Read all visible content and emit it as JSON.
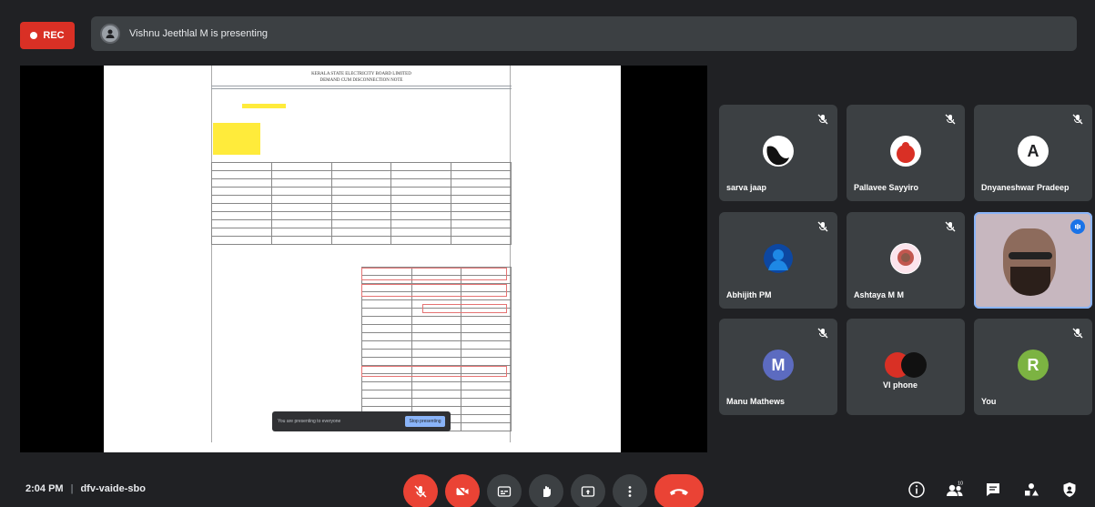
{
  "header": {
    "rec_label": "REC",
    "presenting_text": "Vishnu Jeethlal M is presenting"
  },
  "document": {
    "title_line1": "KERALA STATE ELECTRICITY BOARD LIMITED",
    "title_line2": "DEMAND CUM DISCONNECTION NOTE",
    "caption_text": "You are presenting to everyone",
    "caption_button": "Stop presenting"
  },
  "participants": [
    {
      "name": "sarva jaap",
      "avatar_letter": "",
      "avatar_color": "#ffffff",
      "muted": true
    },
    {
      "name": "Pallavee Sayyiro",
      "avatar_letter": "",
      "avatar_color": "#d93025",
      "muted": true
    },
    {
      "name": "Dnyaneshwar Pradeep",
      "avatar_letter": "A",
      "avatar_color": "#ffffff",
      "muted": true
    },
    {
      "name": "Abhijith PM",
      "avatar_letter": "",
      "avatar_color": "#1a73e8",
      "muted": true
    },
    {
      "name": "Ashtaya M M",
      "avatar_letter": "",
      "avatar_color": "#c2574f",
      "muted": true
    },
    {
      "name": "",
      "video": true,
      "muted": false
    },
    {
      "name": "Manu Mathews",
      "avatar_letter": "M",
      "avatar_color": "#5c6bc0",
      "muted": true
    },
    {
      "name": "VI phone",
      "avatar_letter": "",
      "avatar_color": "#d93025",
      "muted": false
    },
    {
      "name": "You",
      "avatar_letter": "R",
      "avatar_color": "#7cb342",
      "muted": true
    }
  ],
  "footer": {
    "time": "2:04 PM",
    "meeting_code": "dfv-vaide-sbo"
  },
  "icons": {
    "mic_off": "mic-off-icon",
    "camera_off": "camera-off-icon",
    "captions": "captions-icon",
    "raise_hand": "raise-hand-icon",
    "present": "present-icon",
    "more": "more-options-icon",
    "end_call": "end-call-icon",
    "info": "info-icon",
    "people": "people-icon",
    "chat": "chat-icon",
    "activities": "activities-icon",
    "host_controls": "host-controls-icon"
  },
  "colors": {
    "danger": "#ea4335",
    "surface": "#3c4043",
    "background": "#202124",
    "accent": "#8ab4f8"
  }
}
